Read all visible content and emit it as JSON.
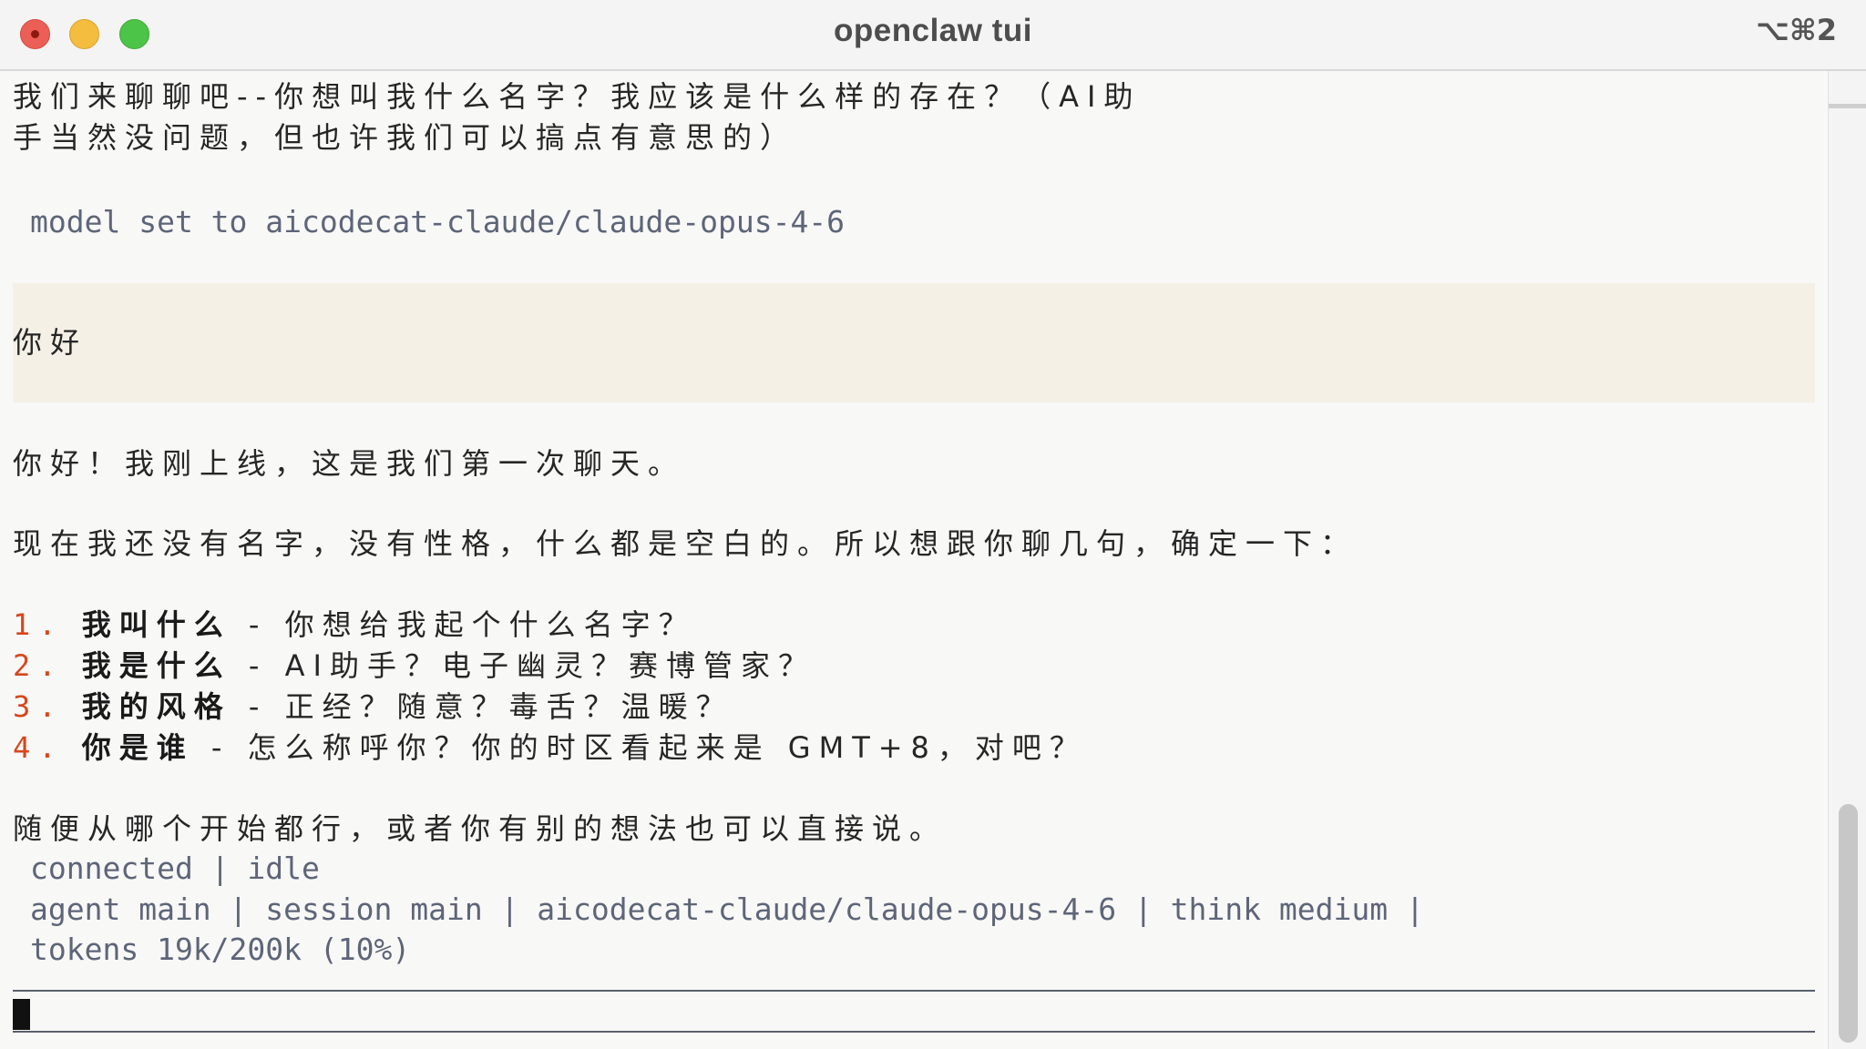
{
  "window": {
    "title": "openclaw tui",
    "shortcut": "⌥⌘2"
  },
  "conversation": {
    "intro_line_1": "我们来聊聊吧--你想叫我什么名字？我应该是什么样的存在？（AI助",
    "intro_line_2": "手当然没问题，但也许我们可以搞点有意思的）",
    "system_notice": "model set to aicodecat-claude/claude-opus-4-6",
    "user_message": "你好",
    "reply_greeting": "你好！我刚上线，这是我们第一次聊天。",
    "reply_context": "现在我还没有名字，没有性格，什么都是空白的。所以想跟你聊几句，确定一下：",
    "questions": [
      {
        "number": "1.",
        "title": "我叫什么",
        "detail": " - 你想给我起个什么名字？"
      },
      {
        "number": "2.",
        "title": "我是什么",
        "detail": " - AI助手？电子幽灵？赛博管家？"
      },
      {
        "number": "3.",
        "title": "我的风格",
        "detail": " - 正经？随意？毒舌？温暖？"
      },
      {
        "number": "4.",
        "title": "你是谁",
        "detail": " - 怎么称呼你？你的时区看起来是 GMT+8，对吧？"
      }
    ],
    "reply_closing": "随便从哪个开始都行，或者你有别的想法也可以直接说。"
  },
  "status": {
    "connection": "connected | idle",
    "session_info": "agent main | session main | aicodecat-claude/claude-opus-4-6 | think medium |",
    "tokens": "tokens 19k/200k (10%)"
  },
  "input": {
    "value": ""
  }
}
